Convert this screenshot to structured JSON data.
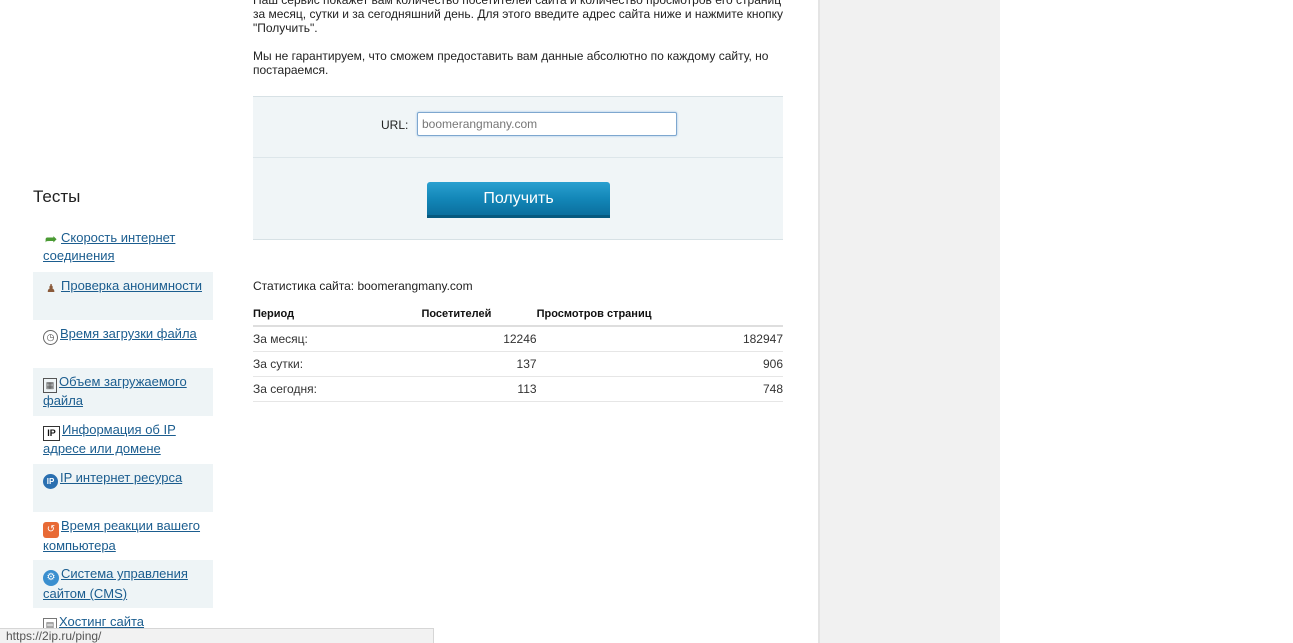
{
  "intro": {
    "paragraph1": "Наш сервис покажет вам количество посетителей сайта и количество просмотров его страниц за месяц, сутки и за сегодняшний день. Для этого введите адрес сайта ниже и нажмите кнопку \"Получить\".",
    "paragraph2": "Мы не гарантируем, что сможем предоставить вам данные абсолютно по каждому сайту, но постараемся."
  },
  "form": {
    "url_label": "URL:",
    "url_value": "boomerangmany.com",
    "submit_label": "Получить"
  },
  "stats": {
    "title": "Статистика сайта: boomerangmany.com",
    "columns": [
      "Период",
      "Посетителей",
      "Просмотров страниц"
    ],
    "rows": [
      {
        "period": "За месяц:",
        "visitors": "12246",
        "views": "182947"
      },
      {
        "period": "За сутки:",
        "visitors": "137",
        "views": "906"
      },
      {
        "period": "За сегодня:",
        "visitors": "113",
        "views": "748"
      }
    ]
  },
  "sidebar": {
    "title": "Тесты",
    "items": [
      {
        "label": "Скорость интернет соединения",
        "icon": "speed-arrow-icon"
      },
      {
        "label": "Проверка анонимности",
        "icon": "anonymous-person-icon"
      },
      {
        "label": "Время загрузки файла",
        "icon": "clock-icon"
      },
      {
        "label": "Объем загружаемого файла",
        "icon": "file-size-icon"
      },
      {
        "label": "Информация об IP адресе или домене",
        "icon": "ip-box-icon"
      },
      {
        "label": "IP интернет ресурса",
        "icon": "ip-circle-icon"
      },
      {
        "label": "Время реакции вашего компьютера",
        "icon": "reaction-icon"
      },
      {
        "label": "Система управления сайтом (CMS)",
        "icon": "cms-icon"
      },
      {
        "label": "Хостинг сайта",
        "icon": "hosting-icon"
      }
    ]
  },
  "status_bar": {
    "url": "https://2ip.ru/ping/"
  }
}
